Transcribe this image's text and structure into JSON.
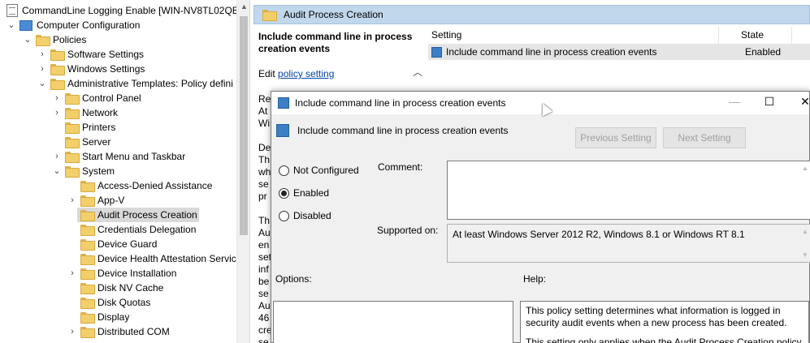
{
  "tree": {
    "items": [
      {
        "label": "CommandLine Logging Enable [WIN-NV8TL02QE",
        "indent": 0,
        "chevron": "",
        "icon": "doc"
      },
      {
        "label": "Computer Configuration",
        "indent": 1,
        "chevron": "v",
        "icon": "pc"
      },
      {
        "label": "Policies",
        "indent": 2,
        "chevron": "v",
        "icon": "folder"
      },
      {
        "label": "Software Settings",
        "indent": 3,
        "chevron": ">",
        "icon": "folder"
      },
      {
        "label": "Windows Settings",
        "indent": 3,
        "chevron": ">",
        "icon": "folder"
      },
      {
        "label": "Administrative Templates: Policy defini",
        "indent": 3,
        "chevron": "v",
        "icon": "folder"
      },
      {
        "label": "Control Panel",
        "indent": 4,
        "chevron": ">",
        "icon": "folder"
      },
      {
        "label": "Network",
        "indent": 4,
        "chevron": ">",
        "icon": "folder"
      },
      {
        "label": "Printers",
        "indent": 4,
        "chevron": "",
        "icon": "folder"
      },
      {
        "label": "Server",
        "indent": 4,
        "chevron": "",
        "icon": "folder"
      },
      {
        "label": "Start Menu and Taskbar",
        "indent": 4,
        "chevron": ">",
        "icon": "folder"
      },
      {
        "label": "System",
        "indent": 4,
        "chevron": "v",
        "icon": "folder"
      },
      {
        "label": "Access-Denied Assistance",
        "indent": 5,
        "chevron": "",
        "icon": "folder"
      },
      {
        "label": "App-V",
        "indent": 5,
        "chevron": ">",
        "icon": "folder"
      },
      {
        "label": "Audit Process Creation",
        "indent": 5,
        "chevron": "",
        "icon": "folder",
        "selected": true
      },
      {
        "label": "Credentials Delegation",
        "indent": 5,
        "chevron": "",
        "icon": "folder"
      },
      {
        "label": "Device Guard",
        "indent": 5,
        "chevron": "",
        "icon": "folder"
      },
      {
        "label": "Device Health Attestation Servic",
        "indent": 5,
        "chevron": "",
        "icon": "folder"
      },
      {
        "label": "Device Installation",
        "indent": 5,
        "chevron": ">",
        "icon": "folder"
      },
      {
        "label": "Disk NV Cache",
        "indent": 5,
        "chevron": "",
        "icon": "folder"
      },
      {
        "label": "Disk Quotas",
        "indent": 5,
        "chevron": "",
        "icon": "folder"
      },
      {
        "label": "Display",
        "indent": 5,
        "chevron": "",
        "icon": "folder"
      },
      {
        "label": "Distributed COM",
        "indent": 5,
        "chevron": ">",
        "icon": "folder"
      }
    ]
  },
  "right": {
    "header_title": "Audit Process Creation",
    "desc_title": "Include command line in process creation events",
    "edit_prefix": "Edit ",
    "edit_link": "policy setting",
    "col_setting": "Setting",
    "col_state": "State",
    "row_setting": "Include command line in process creation events",
    "row_state": "Enabled",
    "peek_lines": [
      "Re",
      "At",
      "Wi",
      "",
      "De",
      "Th",
      "wh",
      "se",
      "pr",
      "",
      "Th",
      "Au",
      "en",
      "set",
      "inf",
      "be",
      "se",
      "Au",
      "46",
      "cre",
      "se"
    ]
  },
  "dialog": {
    "title": "Include command line in process creation events",
    "subtitle": "Include command line in process creation events",
    "prev_btn": "Previous Setting",
    "next_btn": "Next Setting",
    "opt_not_configured": "Not Configured",
    "opt_enabled": "Enabled",
    "opt_disabled": "Disabled",
    "selected_option": "enabled",
    "comment_label": "Comment:",
    "supported_label": "Supported on:",
    "supported_value": "At least Windows Server 2012 R2, Windows 8.1 or Windows RT 8.1",
    "options_label": "Options:",
    "help_label": "Help:",
    "help_p1": "This policy setting determines what information is logged in security audit events when a new process has been created.",
    "help_p2_partial": "This setting only applies when the Audit Process Creation policy"
  }
}
